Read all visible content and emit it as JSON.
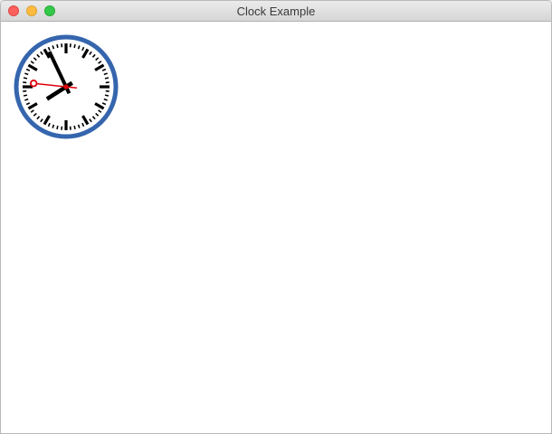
{
  "window": {
    "title": "Clock Example"
  },
  "titlebar_buttons": [
    {
      "name": "close",
      "color": "#fc605c"
    },
    {
      "name": "minimize",
      "color": "#fdbc40"
    },
    {
      "name": "zoom",
      "color": "#34c84a"
    }
  ],
  "clock": {
    "hours": 7,
    "minutes": 55,
    "seconds": 46,
    "face_color": "#ffffff",
    "rim_color": "#3565ad",
    "hand_color": "#000000",
    "second_hand_color": "#e0000b"
  }
}
